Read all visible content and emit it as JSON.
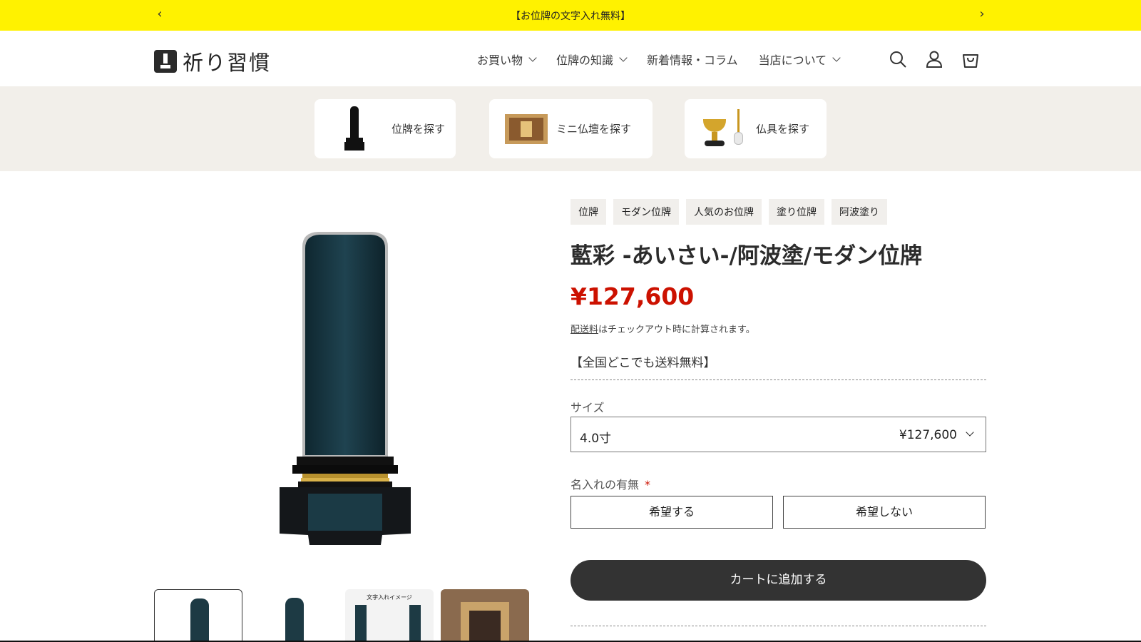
{
  "announcement": {
    "text": "【お位牌の文字入れ無料】",
    "prev_icon": "chevron-left-icon",
    "next_icon": "chevron-right-icon"
  },
  "header": {
    "logo_text": "祈り習慣",
    "nav": [
      {
        "label": "お買い物",
        "has_dropdown": true
      },
      {
        "label": "位牌の知識",
        "has_dropdown": true
      },
      {
        "label": "新着情報・コラム",
        "has_dropdown": false
      },
      {
        "label": "当店について",
        "has_dropdown": true
      }
    ],
    "icons": [
      "search-icon",
      "account-icon",
      "cart-icon"
    ]
  },
  "categories": [
    {
      "label": "位牌を探す",
      "icon": "ihai-icon"
    },
    {
      "label": "ミニ仏壇を探す",
      "icon": "mini-butsudan-icon"
    },
    {
      "label": "仏具を探す",
      "icon": "butsugu-icon"
    }
  ],
  "product": {
    "tags": [
      "位牌",
      "モダン位牌",
      "人気のお位牌",
      "塗り位牌",
      "阿波塗り"
    ],
    "title": "藍彩 -あいさい-/阿波塗/モダン位牌",
    "price": "¥127,600",
    "shipping_link": "配送料",
    "shipping_note": "はチェックアウト時に計算されます。",
    "free_shipping": "【全国どこでも送料無料】",
    "size_label": "サイズ",
    "size_value": "4.0寸",
    "size_price": "¥127,600",
    "name_label": "名入れの有無",
    "required_mark": "*",
    "options": [
      "希望する",
      "希望しない"
    ],
    "add_to_cart": "カートに追加する",
    "thumbnail_caption": "文字入れイメージ"
  },
  "colors": {
    "announcement_bg": "#fff200",
    "price": "#cc1100",
    "cart_button": "#333333",
    "band_bg": "#f2efea",
    "ihai_body": "#1d3a44"
  }
}
